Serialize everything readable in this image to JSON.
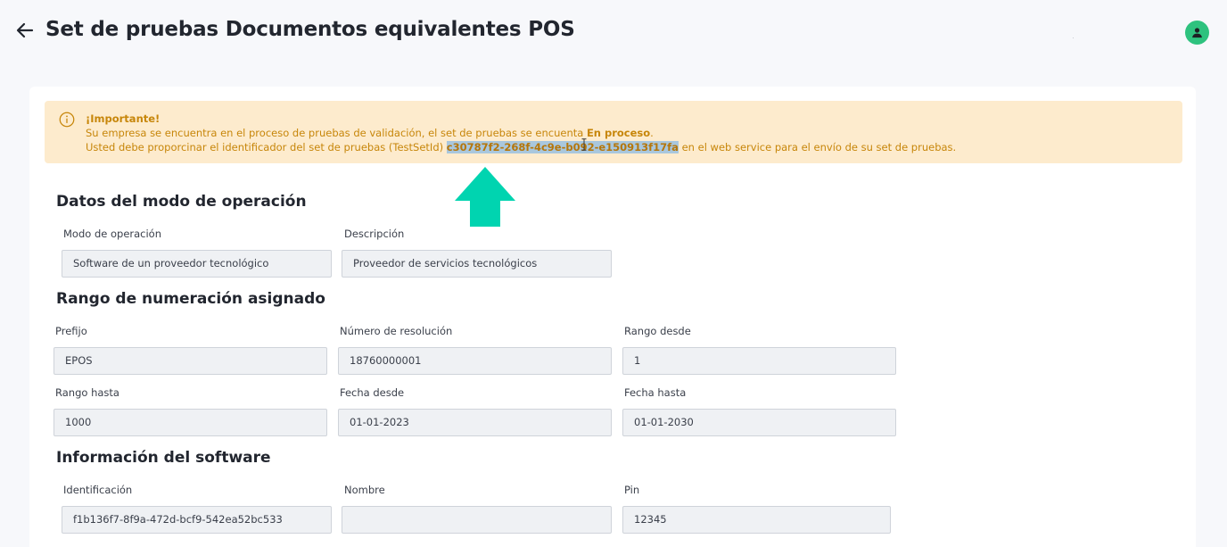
{
  "header": {
    "title": "Set de pruebas Documentos equivalentes POS",
    "back_icon": "arrow-left-icon",
    "avatar_icon": "user-icon",
    "accent_color": "#2ec27e"
  },
  "alert": {
    "title": "¡Importante!",
    "line1_prefix": "Su empresa se encuentra en el proceso de pruebas de validación, el set de pruebas se encuenta ",
    "line1_status": "En proceso",
    "line1_suffix": ".",
    "line2_prefix": "Usted debe proporcinar el identificador del set de pruebas (TestSetId) ",
    "line2_testset_id": "c30787f2-268f-4c9e-b092-e150913f17fa",
    "line2_suffix": " en el web service para el envío de su set de pruebas.",
    "icon": "info-icon",
    "background_color": "#fdebcd",
    "text_color": "#c7860a"
  },
  "annotation": {
    "arrow_icon": "arrow-up-icon",
    "color": "#00d4b0"
  },
  "sections": {
    "operation": {
      "title": "Datos del modo de operación",
      "mode_label": "Modo de operación",
      "mode_value": "Software de un proveedor tecnológico",
      "description_label": "Descripción",
      "description_value": "Proveedor de servicios tecnológicos"
    },
    "numbering": {
      "title": "Rango de numeración asignado",
      "prefix_label": "Prefijo",
      "prefix_value": "EPOS",
      "resolution_label": "Número de resolución",
      "resolution_value": "18760000001",
      "from_label": "Rango desde",
      "from_value": "1",
      "to_label": "Rango hasta",
      "to_value": "1000",
      "date_from_label": "Fecha desde",
      "date_from_value": "01-01-2023",
      "date_to_label": "Fecha hasta",
      "date_to_value": "01-01-2030"
    },
    "software": {
      "title": "Información del software",
      "id_label": "Identificación",
      "id_value": "f1b136f7-8f9a-472d-bcf9-542ea52bc533",
      "name_label": "Nombre",
      "name_value": "",
      "pin_label": "Pin",
      "pin_value": "12345"
    }
  }
}
